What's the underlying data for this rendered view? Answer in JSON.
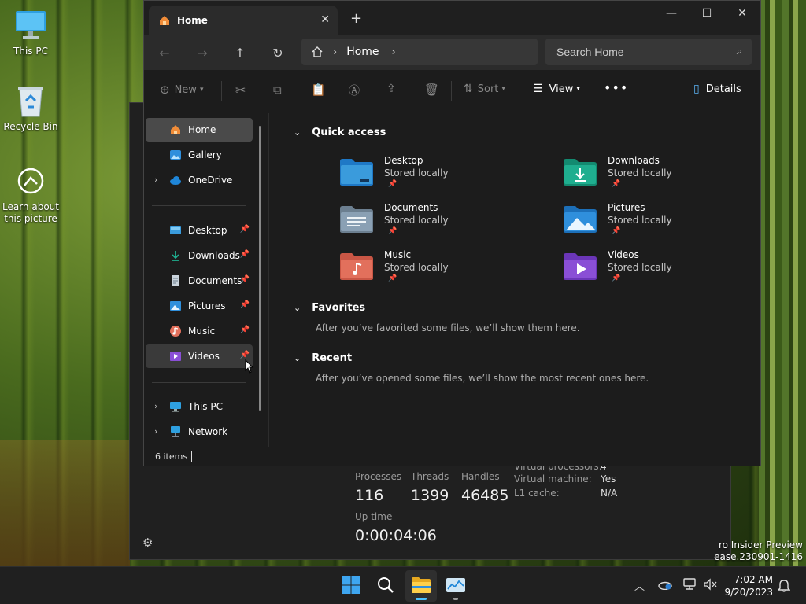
{
  "desktop": {
    "icons": [
      {
        "label": "This PC",
        "icon": "monitor-icon"
      },
      {
        "label": "Recycle Bin",
        "icon": "recycle-bin-icon"
      },
      {
        "label": "Learn about this picture",
        "icon": "info-icon"
      }
    ],
    "watermark": [
      "ro Insider Preview",
      "ease.230901-1416"
    ]
  },
  "taskmgr": {
    "processes_label": "Processes",
    "processes": "116",
    "threads_label": "Threads",
    "threads": "1399",
    "handles_label": "Handles",
    "handles": "46485",
    "uptime_label": "Up time",
    "uptime": "0:00:04:06",
    "virtual_processors_label": "Virtual processors:",
    "virtual_processors": "4",
    "virtual_machine_label": "Virtual machine:",
    "virtual_machine": "Yes",
    "l1_cache_label": "L1 cache:",
    "l1_cache": "N/A"
  },
  "explorer": {
    "tab_title": "Home",
    "address": "Home",
    "search_placeholder": "Search Home",
    "toolbar": {
      "new_label": "New",
      "sort_label": "Sort",
      "view_label": "View",
      "details_label": "Details"
    },
    "sidebar": {
      "items": [
        {
          "label": "Home",
          "icon": "home-icon"
        },
        {
          "label": "Gallery",
          "icon": "gallery-icon"
        },
        {
          "label": "OneDrive",
          "icon": "cloud-icon"
        },
        {
          "label": "Desktop",
          "icon": "desktop-folder-icon"
        },
        {
          "label": "Downloads",
          "icon": "download-icon"
        },
        {
          "label": "Documents",
          "icon": "document-icon"
        },
        {
          "label": "Pictures",
          "icon": "picture-icon"
        },
        {
          "label": "Music",
          "icon": "music-icon"
        },
        {
          "label": "Videos",
          "icon": "video-icon"
        },
        {
          "label": "This PC",
          "icon": "monitor-icon"
        },
        {
          "label": "Network",
          "icon": "network-icon"
        }
      ]
    },
    "quick_access": {
      "title": "Quick access",
      "items": [
        {
          "name": "Desktop",
          "sub": "Stored locally",
          "color": "#3a9bdc"
        },
        {
          "name": "Downloads",
          "sub": "Stored locally",
          "color": "#1fae8f"
        },
        {
          "name": "Documents",
          "sub": "Stored locally",
          "color": "#8aa0b4"
        },
        {
          "name": "Pictures",
          "sub": "Stored locally",
          "color": "#2f8fdc"
        },
        {
          "name": "Music",
          "sub": "Stored locally",
          "color": "#e2705c"
        },
        {
          "name": "Videos",
          "sub": "Stored locally",
          "color": "#8a4fd6"
        }
      ]
    },
    "favorites": {
      "title": "Favorites",
      "message": "After you’ve favorited some files, we’ll show them here."
    },
    "recent": {
      "title": "Recent",
      "message": "After you’ve opened some files, we’ll show the most recent ones here."
    },
    "status": "6 items"
  },
  "taskbar": {
    "time": "7:02 AM",
    "date": "9/20/2023",
    "accent": "#4cc2ff"
  }
}
